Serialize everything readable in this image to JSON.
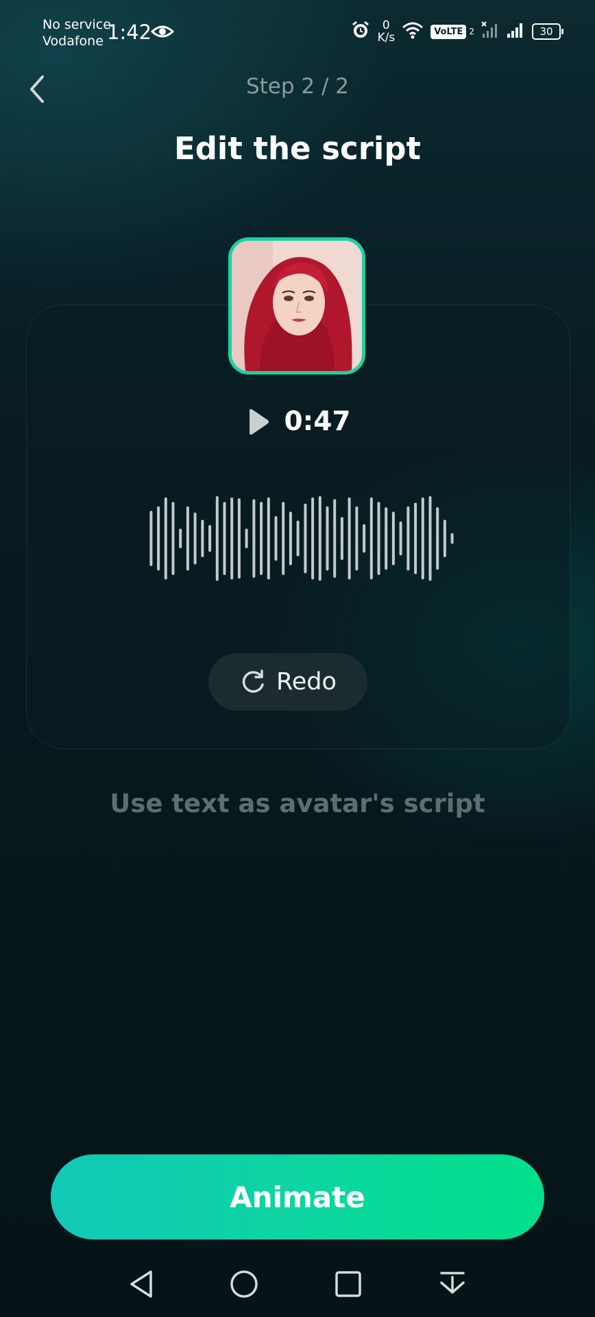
{
  "status_bar": {
    "carrier_line1": "No service",
    "carrier_line2": "Vodafone",
    "time": "1:42",
    "net_speed_value": "0",
    "net_speed_unit": "K/s",
    "volte": "VoLTE",
    "sim2": "2",
    "battery": "30",
    "icons": [
      "eye-icon",
      "alarm-icon",
      "wifi-icon",
      "signal-icon",
      "battery-icon"
    ]
  },
  "header": {
    "step": "Step 2 / 2",
    "title": "Edit the script",
    "back_icon": "chevron-left-icon"
  },
  "card": {
    "duration": "0:47",
    "play_icon": "play-icon",
    "redo_label": "Redo",
    "redo_icon": "refresh-icon",
    "waveform_levels": [
      0.62,
      0.72,
      0.92,
      0.82,
      0.22,
      0.72,
      0.58,
      0.42,
      0.3,
      0.95,
      0.82,
      0.92,
      0.9,
      0.22,
      0.88,
      0.82,
      0.92,
      0.5,
      0.82,
      0.6,
      0.4,
      0.78,
      0.92,
      0.95,
      0.72,
      0.88,
      0.48,
      0.92,
      0.72,
      0.32,
      0.92,
      0.82,
      0.7,
      0.6,
      0.38,
      0.72,
      0.8,
      0.92,
      0.95,
      0.7,
      0.42,
      0.12
    ]
  },
  "script_option": "Use text as avatar's script",
  "cta": {
    "label": "Animate"
  },
  "nav": [
    "back-triangle-icon",
    "home-circle-icon",
    "recents-square-icon",
    "dropdown-menu-icon"
  ],
  "colors": {
    "accent": "#19d3a1",
    "cta_start": "#12c9b8",
    "cta_end": "#00e08a",
    "background": "#071a20"
  }
}
